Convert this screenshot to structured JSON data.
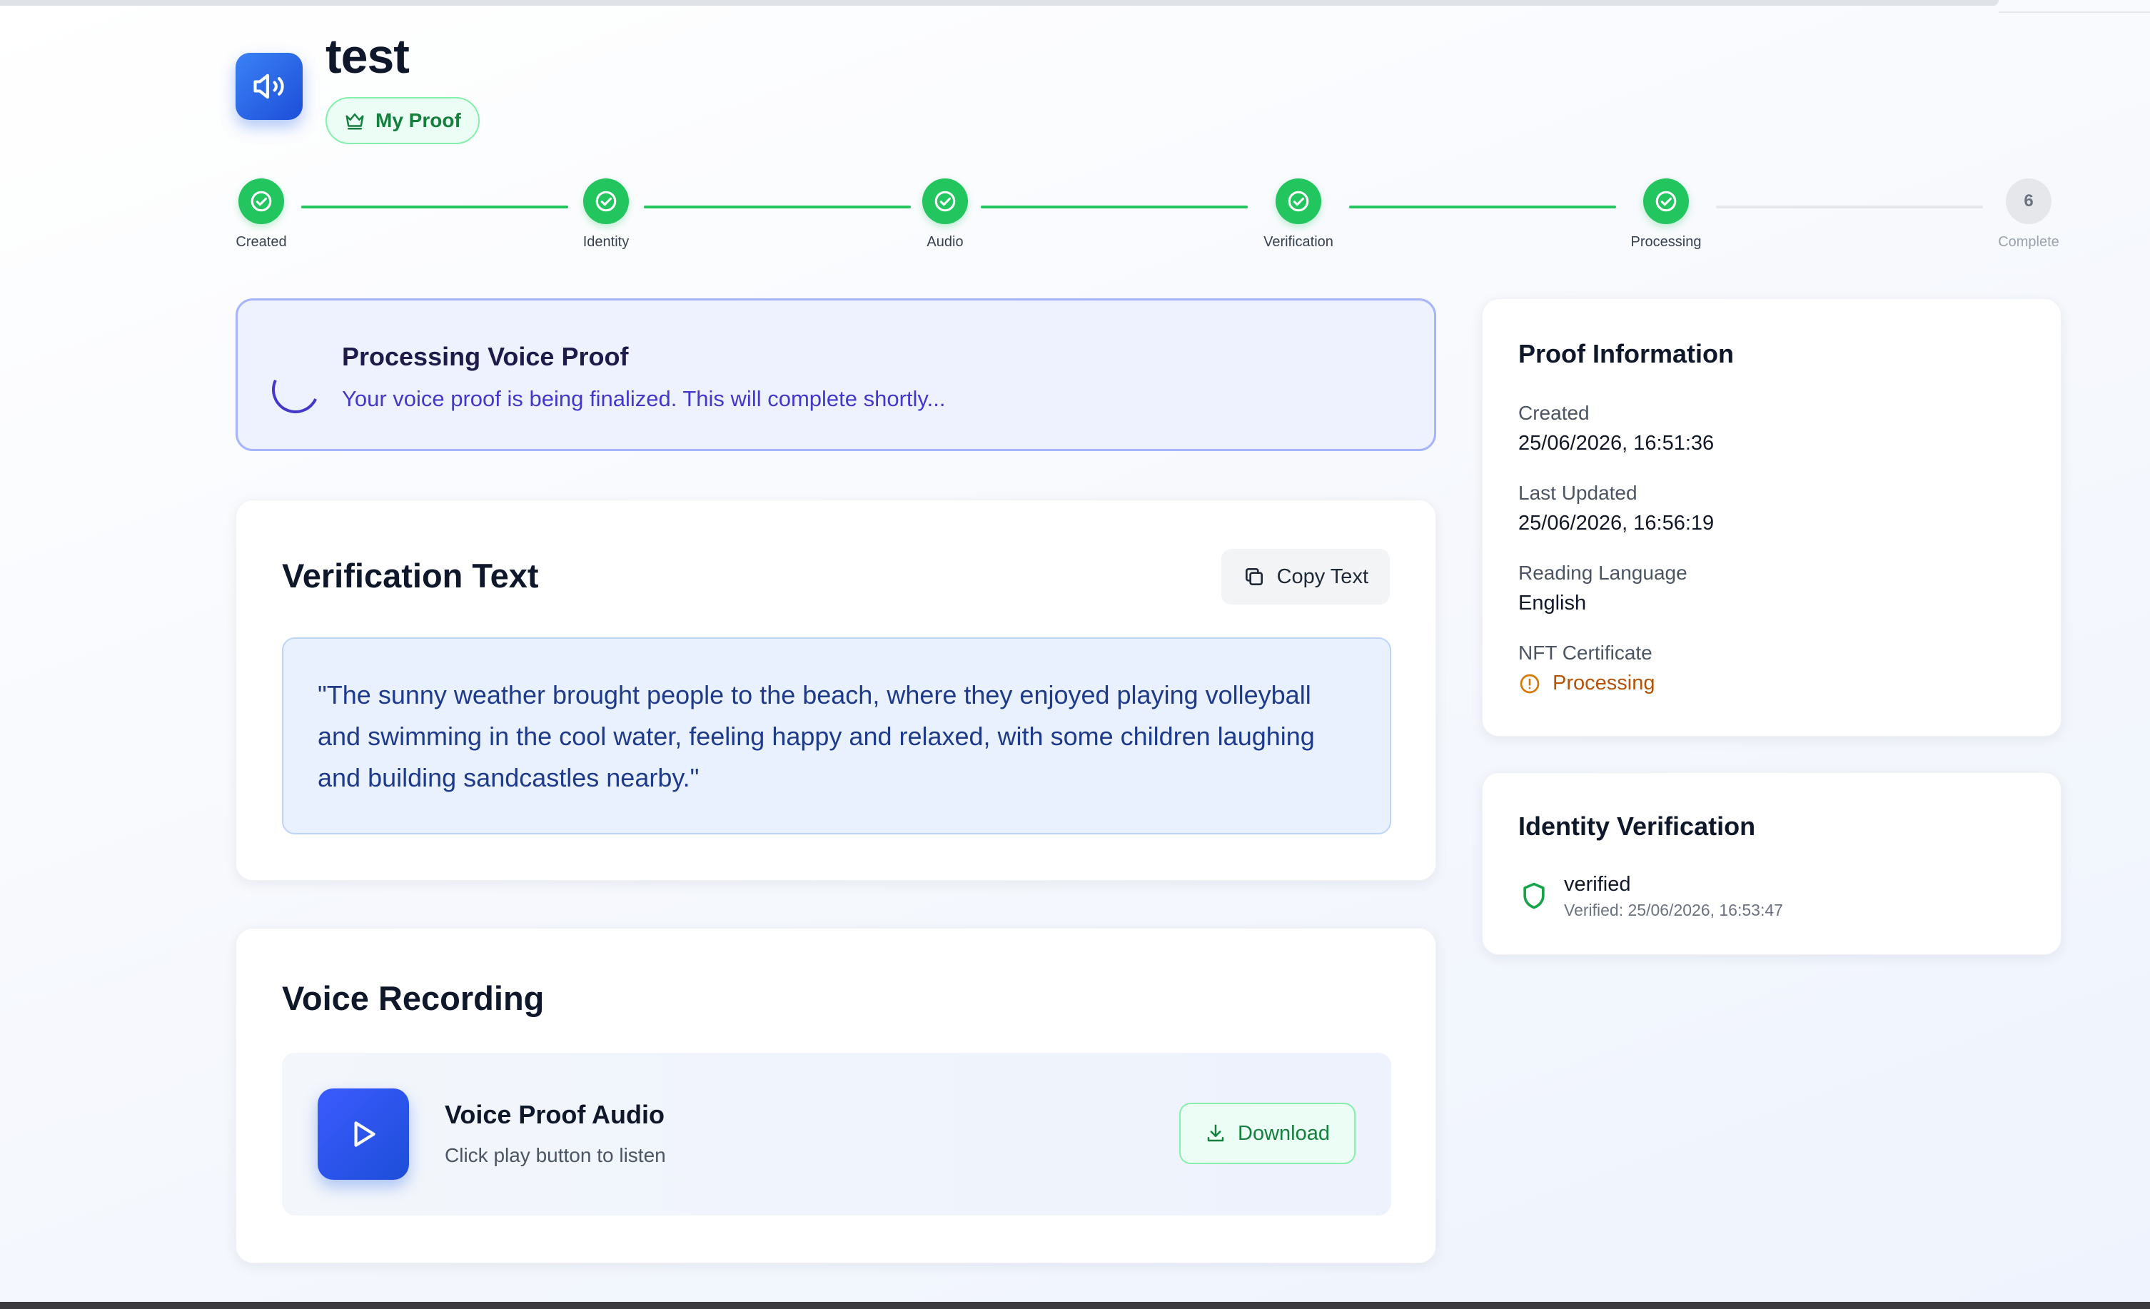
{
  "header": {
    "title": "test",
    "badge_label": "My Proof"
  },
  "stepper": {
    "steps": [
      {
        "label": "Created",
        "status": "done"
      },
      {
        "label": "Identity",
        "status": "done"
      },
      {
        "label": "Audio",
        "status": "done"
      },
      {
        "label": "Verification",
        "status": "done"
      },
      {
        "label": "Processing",
        "status": "done"
      },
      {
        "label": "Complete",
        "status": "pending",
        "number": "6"
      }
    ]
  },
  "banner": {
    "title": "Processing Voice Proof",
    "subtitle": "Your voice proof is being finalized. This will complete shortly..."
  },
  "verification_text": {
    "title": "Verification Text",
    "copy_label": "Copy Text",
    "quote": "\"The sunny weather brought people to the beach, where they enjoyed playing volleyball and swimming in the cool water, feeling happy and relaxed, with some children laughing and building sandcastles nearby.\""
  },
  "voice_recording": {
    "title": "Voice Recording",
    "audio_title": "Voice Proof Audio",
    "audio_subtitle": "Click play button to listen",
    "download_label": "Download"
  },
  "proof_information": {
    "title": "Proof Information",
    "created_label": "Created",
    "created_value": "25/06/2026, 16:51:36",
    "updated_label": "Last Updated",
    "updated_value": "25/06/2026, 16:56:19",
    "language_label": "Reading Language",
    "language_value": "English",
    "nft_label": "NFT Certificate",
    "nft_status": "Processing"
  },
  "identity_verification": {
    "title": "Identity Verification",
    "status": "verified",
    "verified_date": "Verified: 25/06/2026, 16:53:47"
  },
  "colors": {
    "accent_blue": "#2563eb",
    "success_green": "#22c55e",
    "warning_amber": "#d97706",
    "banner_indigo": "#4338ca"
  },
  "icons": {
    "app": "speaker-icon",
    "badge": "crown-icon",
    "step_done": "check-circle-icon",
    "copy": "copy-icon",
    "play": "play-icon",
    "download": "download-icon",
    "nft_status": "alert-circle-icon",
    "identity": "shield-icon"
  }
}
